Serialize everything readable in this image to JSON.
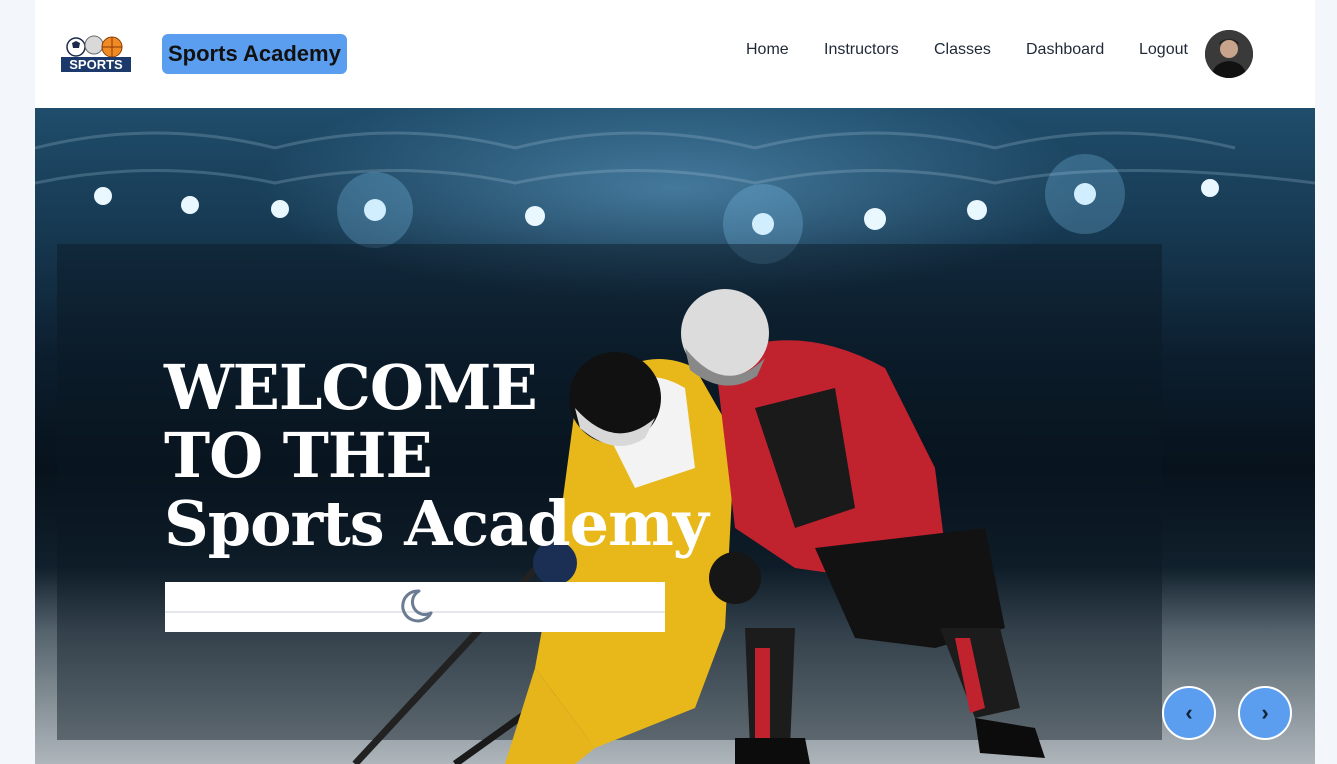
{
  "navbar": {
    "logo_text": "SPORTS",
    "brand": "Sports Academy",
    "links": [
      {
        "label": "Home"
      },
      {
        "label": "Instructors"
      },
      {
        "label": "Classes"
      },
      {
        "label": "Dashboard"
      },
      {
        "label": "Logout"
      }
    ]
  },
  "hero": {
    "line1": "WELCOME",
    "line2": "TO THE",
    "line3": "Sports Academy",
    "prev_icon": "chevron-left-icon",
    "next_icon": "chevron-right-icon",
    "prev_label": "‹",
    "next_label": "›"
  },
  "theme_toggle": {
    "icon": "moon-icon"
  },
  "colors": {
    "accent": "#5b9ef0",
    "text": "#1f2937"
  }
}
